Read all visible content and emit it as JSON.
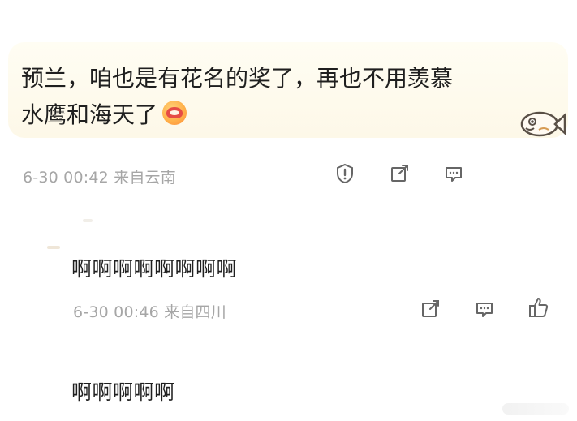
{
  "comment": {
    "text_line1": "预兰，咱也是有花名的奖了，再也不用羡慕",
    "text_line2": "水鹰和海天了",
    "emoji_icon": "hugging-face-icon",
    "sticker_icon": "fish-sticker-icon",
    "meta": "6-30 00:42 来自云南",
    "actions": [
      {
        "icon": "report-icon"
      },
      {
        "icon": "share-icon"
      },
      {
        "icon": "comment-icon"
      }
    ]
  },
  "replies": [
    {
      "text": "啊啊啊啊啊啊啊啊",
      "meta": "6-30 00:46 来自四川",
      "actions": [
        {
          "icon": "share-icon"
        },
        {
          "icon": "comment-icon"
        },
        {
          "icon": "like-icon"
        }
      ]
    },
    {
      "text": "啊啊啊啊啊"
    }
  ]
}
